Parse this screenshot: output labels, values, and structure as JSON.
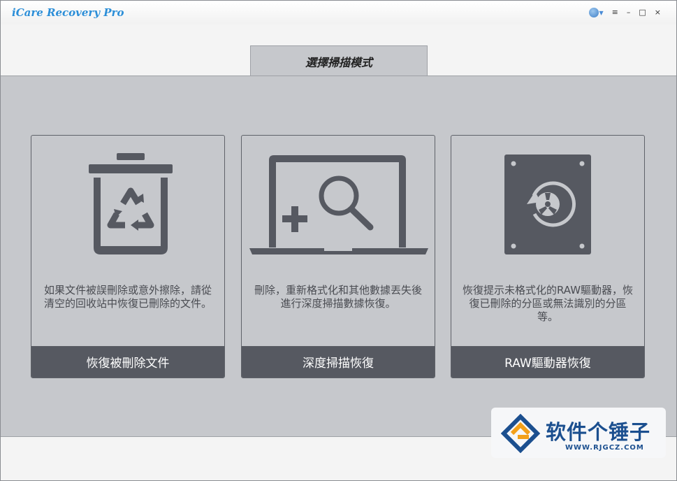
{
  "window": {
    "title": "iCare Recovery Pro",
    "controls": {
      "menu": "≡",
      "minimize": "–",
      "maximize": "□",
      "close": "×"
    }
  },
  "mode_tab": {
    "label": "選擇掃描模式"
  },
  "cards": [
    {
      "icon": "recycle-bin-icon",
      "description": "如果文件被誤刪除或意外擦除，請從清空的回收站中恢復已刪除的文件。",
      "button": "恢復被刪除文件"
    },
    {
      "icon": "laptop-search-icon",
      "description": "刪除，重新格式化和其他數據丟失後進行深度掃描數據恢復。",
      "button": "深度掃描恢復"
    },
    {
      "icon": "hard-drive-restore-icon",
      "description": "恢復提示未格式化的RAW驅動器，恢復已刪除的分區或無法識別的分區等。",
      "button": "RAW驅動器恢復"
    }
  ],
  "watermark": {
    "text": "软件个锤子",
    "url": "WWW.RJGCZ.COM"
  },
  "colors": {
    "panel": "#c6c8cc",
    "icon": "#565961",
    "button": "#565961",
    "title_accent": "#2b8ed8"
  }
}
